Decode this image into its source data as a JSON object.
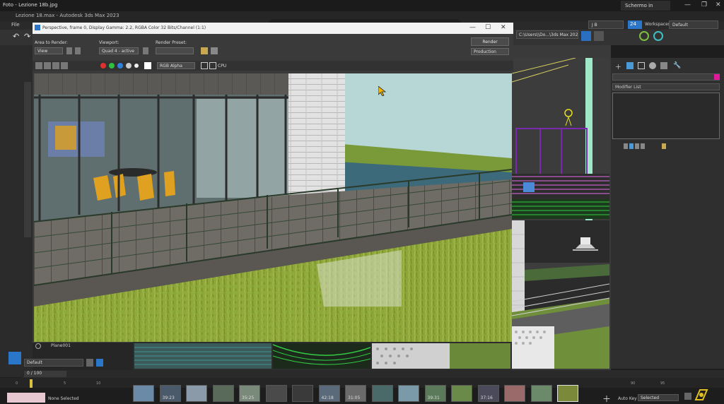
{
  "os": {
    "title": "Foto - Lezione 18b.jpg",
    "screen_button": "Schermo in"
  },
  "max": {
    "title": "Lezione 18.max - Autodesk 3ds Max 2023",
    "menu_first": "File",
    "path": "C:\\Users\\\\Do...\\3ds Max 202",
    "user": "J B",
    "badge_number": "24",
    "workspaces_label": "Workspaces:",
    "workspaces_value": "Default"
  },
  "render_frame": {
    "title": "Perspective, frame 0, Display Gamma: 2.2, RGBA Color 32 Bits/Channel (1:1)",
    "area_label": "Area to Render:",
    "area_value": "View",
    "viewport_label": "Viewport:",
    "viewport_value": "Quad 4 - active",
    "preset_label": "Render Preset:",
    "preset_value": "",
    "render_button": "Render",
    "production_value": "Production",
    "channel_value": "RGB Alpha",
    "engine_label": "CPU"
  },
  "command_panel": {
    "modifier_list": "Modifier List"
  },
  "scene_explorer": {
    "object": "Plane001",
    "layer_value": "Default"
  },
  "timeline": {
    "frame_counter": "0 / 100",
    "ruler_left": [
      "0",
      "5",
      "10"
    ],
    "ruler_right": [
      "90",
      "95"
    ],
    "thumbnail_times": [
      "",
      "39:23",
      "",
      "",
      "35:25",
      "",
      "",
      "42:18",
      "31:05",
      "",
      "",
      "39:31",
      "",
      "37:16",
      "",
      "",
      ""
    ]
  },
  "status": {
    "selection_text": "None Selected",
    "auto_key": "Auto Key",
    "selected_value": "Selected"
  }
}
